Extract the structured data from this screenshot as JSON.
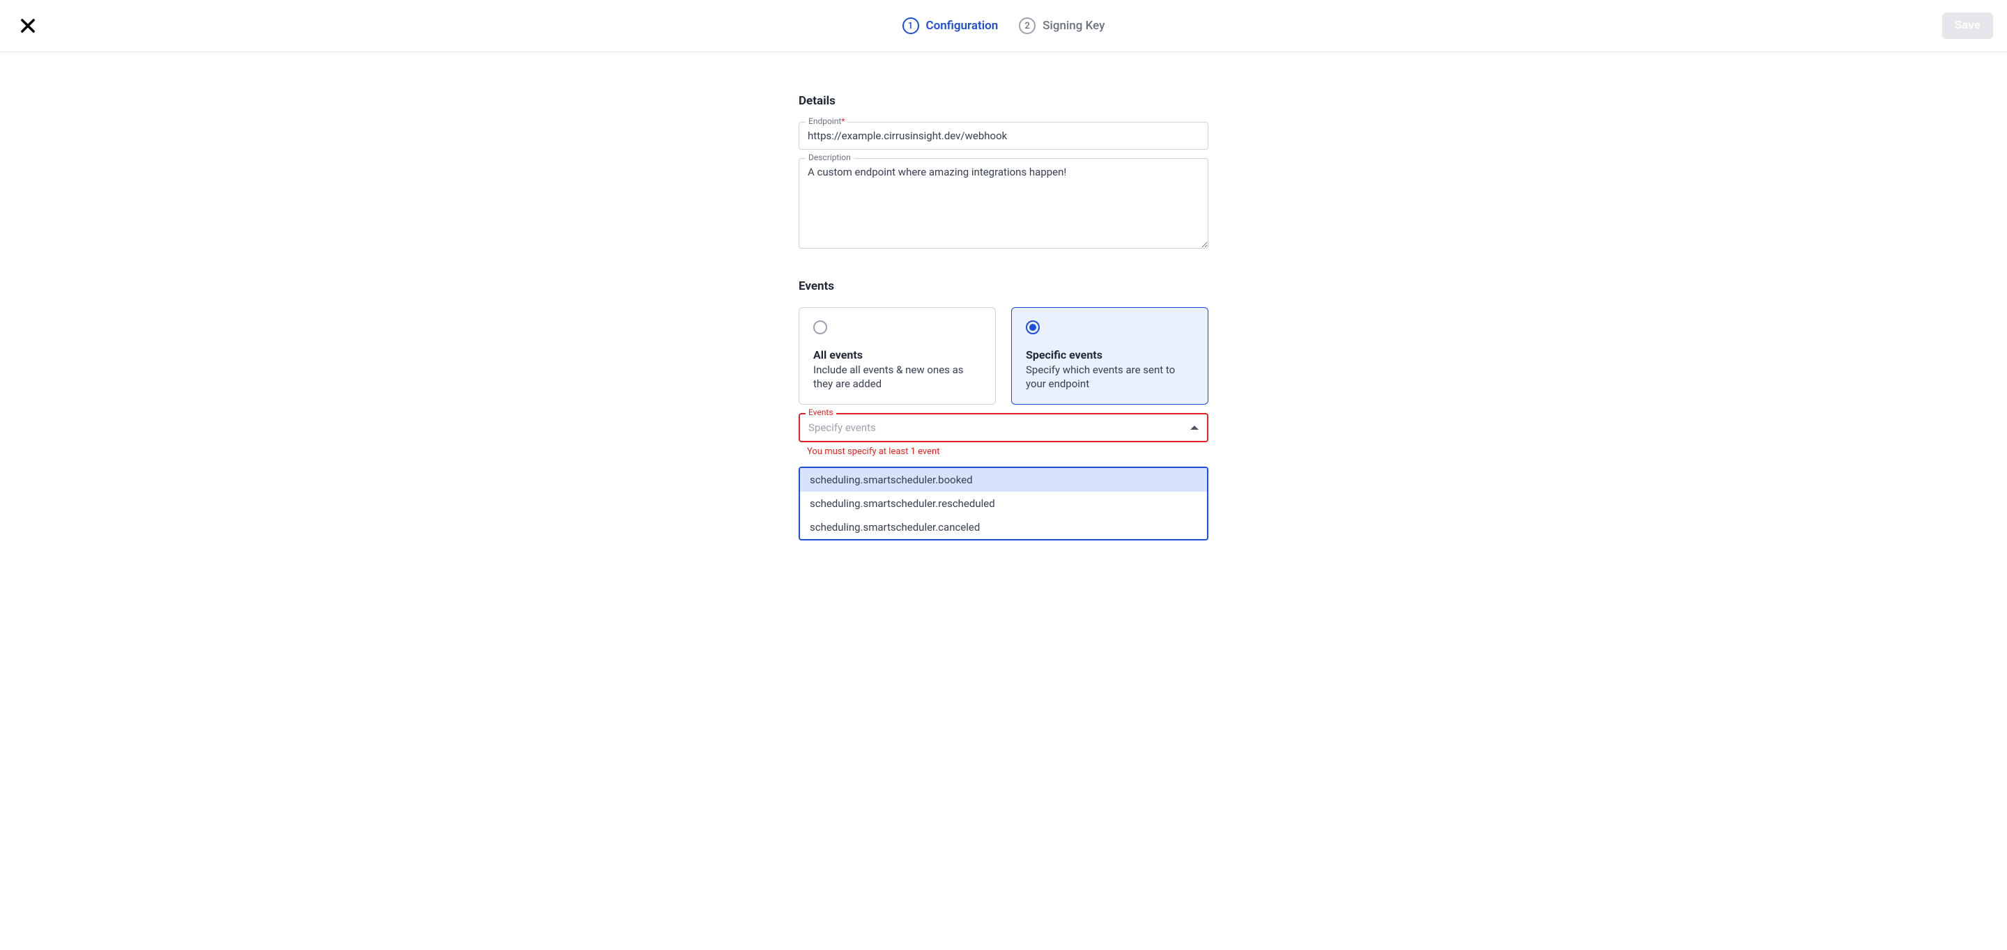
{
  "header": {
    "steps": [
      {
        "number": "1",
        "label": "Configuration"
      },
      {
        "number": "2",
        "label": "Signing Key"
      }
    ],
    "save_label": "Save"
  },
  "details": {
    "section_title": "Details",
    "endpoint_label": "Endpoint",
    "endpoint_value": "https://example.cirrusinsight.dev/webhook",
    "description_label": "Description",
    "description_value": "A custom endpoint where amazing integrations happen!"
  },
  "events": {
    "section_title": "Events",
    "all": {
      "title": "All events",
      "desc": "Include all events & new ones as they are added"
    },
    "specific": {
      "title": "Specific events",
      "desc": "Specify which events are sent to your endpoint"
    },
    "select_label": "Events",
    "select_placeholder": "Specify events",
    "error": "You must specify at least 1 event",
    "options": [
      "scheduling.smartscheduler.booked",
      "scheduling.smartscheduler.rescheduled",
      "scheduling.smartscheduler.canceled"
    ]
  }
}
